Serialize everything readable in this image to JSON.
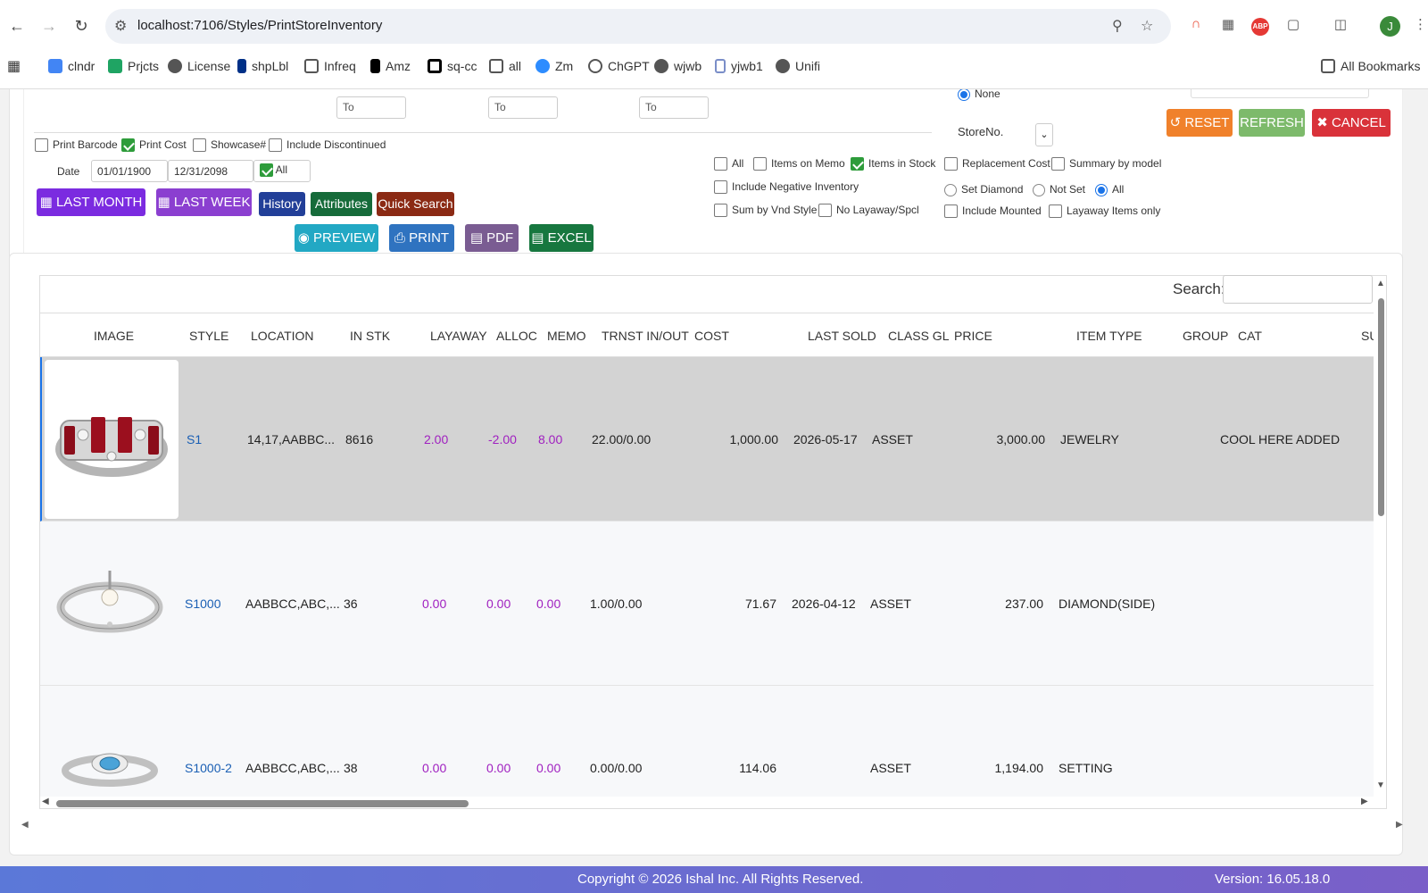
{
  "browser": {
    "url": "localhost:7106/Styles/PrintStoreInventory",
    "avatar_letter": "J",
    "abp_label": "ABP",
    "bookmarks": [
      {
        "label": "clndr",
        "icon": "calendar-icon",
        "color": "#4285f4"
      },
      {
        "label": "Prjcts",
        "icon": "drive-icon",
        "color": "#1fa463"
      },
      {
        "label": "License",
        "icon": "globe-icon",
        "color": "#555555"
      },
      {
        "label": "shpLbl",
        "icon": "paypal-icon",
        "color": "#003087"
      },
      {
        "label": "Infreq",
        "icon": "folder-icon",
        "color": "#555555"
      },
      {
        "label": "Amz",
        "icon": "amazon-icon",
        "color": "#000000"
      },
      {
        "label": "sq-cc",
        "icon": "square-icon",
        "color": "#000000"
      },
      {
        "label": "all",
        "icon": "folder-icon",
        "color": "#555555"
      },
      {
        "label": "Zm",
        "icon": "zoom-icon",
        "color": "#2d8cff"
      },
      {
        "label": "ChGPT",
        "icon": "chatgpt-icon",
        "color": "#555555"
      },
      {
        "label": "wjwb",
        "icon": "globe-icon",
        "color": "#555555"
      },
      {
        "label": "yjwb1",
        "icon": "doc-icon",
        "color": "#7a8ec8"
      },
      {
        "label": "Unifi",
        "icon": "globe-icon",
        "color": "#555555"
      }
    ],
    "all_bookmarks": "All Bookmarks"
  },
  "filters": {
    "to_placeholder": "To",
    "radio_none": "None",
    "store_label": "StoreNo.",
    "print_barcode": "Print Barcode",
    "print_cost": "Print Cost",
    "showcase": "Showcase#",
    "include_discontinued": "Include Discontinued",
    "date_label": "Date",
    "date_from": "01/01/1900",
    "date_to": "12/31/2098",
    "date_all": "All",
    "opt_all": "All",
    "items_on_memo": "Items on Memo",
    "items_in_stock": "Items in Stock",
    "include_negative": "Include Negative Inventory",
    "sum_by_vnd_style": "Sum by Vnd Style",
    "no_layaway": "No Layaway/Spcl",
    "replacement_cost": "Replacement Cost",
    "summary_by_model": "Summary by model",
    "set_diamond": "Set Diamond",
    "not_set": "Not Set",
    "diamond_all": "All",
    "include_mounted": "Include Mounted",
    "layaway_items_only": "Layaway Items only"
  },
  "buttons": {
    "reset": "RESET",
    "refresh": "REFRESH",
    "cancel": "CANCEL",
    "last_month": "LAST MONTH",
    "last_week": "LAST WEEK",
    "history": "History",
    "attributes": "Attributes",
    "quick_search": "Quick Search",
    "preview": "PREVIEW",
    "print": "PRINT",
    "pdf": "PDF",
    "excel": "EXCEL"
  },
  "table": {
    "search_label": "Search:",
    "columns": [
      "IMAGE",
      "STYLE",
      "LOCATION",
      "IN STK",
      "LAYAWAY",
      "ALLOC",
      "MEMO",
      "TRNST IN/OUT",
      "COST",
      "LAST SOLD",
      "CLASS GL",
      "PRICE",
      "ITEM TYPE",
      "GROUP",
      "CAT",
      "SU"
    ],
    "rows": [
      {
        "style": "S1",
        "location": "14,17,AABBC...",
        "in_stk": "8616",
        "layaway": "2.00",
        "alloc": "-2.00",
        "memo": "8.00",
        "trnst": "22.00/0.00",
        "cost": "1,000.00",
        "last_sold": "2026-05-17",
        "class_gl": "ASSET",
        "price": "3,000.00",
        "item_type": "JEWELRY",
        "group": "",
        "cat": "COOL HERE ADDED"
      },
      {
        "style": "S1000",
        "location": "AABBCC,ABC,...",
        "in_stk": "36",
        "layaway": "0.00",
        "alloc": "0.00",
        "memo": "0.00",
        "trnst": "1.00/0.00",
        "cost": "71.67",
        "last_sold": "2026-04-12",
        "class_gl": "ASSET",
        "price": "237.00",
        "item_type": "DIAMOND(SIDE)",
        "group": "",
        "cat": ""
      },
      {
        "style": "S1000-2",
        "location": "AABBCC,ABC,...",
        "in_stk": "38",
        "layaway": "0.00",
        "alloc": "0.00",
        "memo": "0.00",
        "trnst": "0.00/0.00",
        "cost": "114.06",
        "last_sold": "",
        "class_gl": "ASSET",
        "price": "1,194.00",
        "item_type": "SETTING",
        "group": "",
        "cat": ""
      }
    ]
  },
  "footer": {
    "copyright": "Copyright © 2026 Ishal Inc. All Rights Reserved.",
    "version": "Version: 16.05.18.0"
  },
  "colors": {
    "reset": "#f0812b",
    "refresh": "#7dba6b",
    "cancel": "#d9323a",
    "last_month": "#7b2be0",
    "last_week": "#8b3fd0",
    "history": "#223f98",
    "attributes": "#166b3a",
    "quick_search": "#8b2a14",
    "preview": "#22a8c4",
    "print": "#2f73c0",
    "pdf": "#7a5c92",
    "excel": "#17773f",
    "selected_row": "#d3d3d3"
  }
}
